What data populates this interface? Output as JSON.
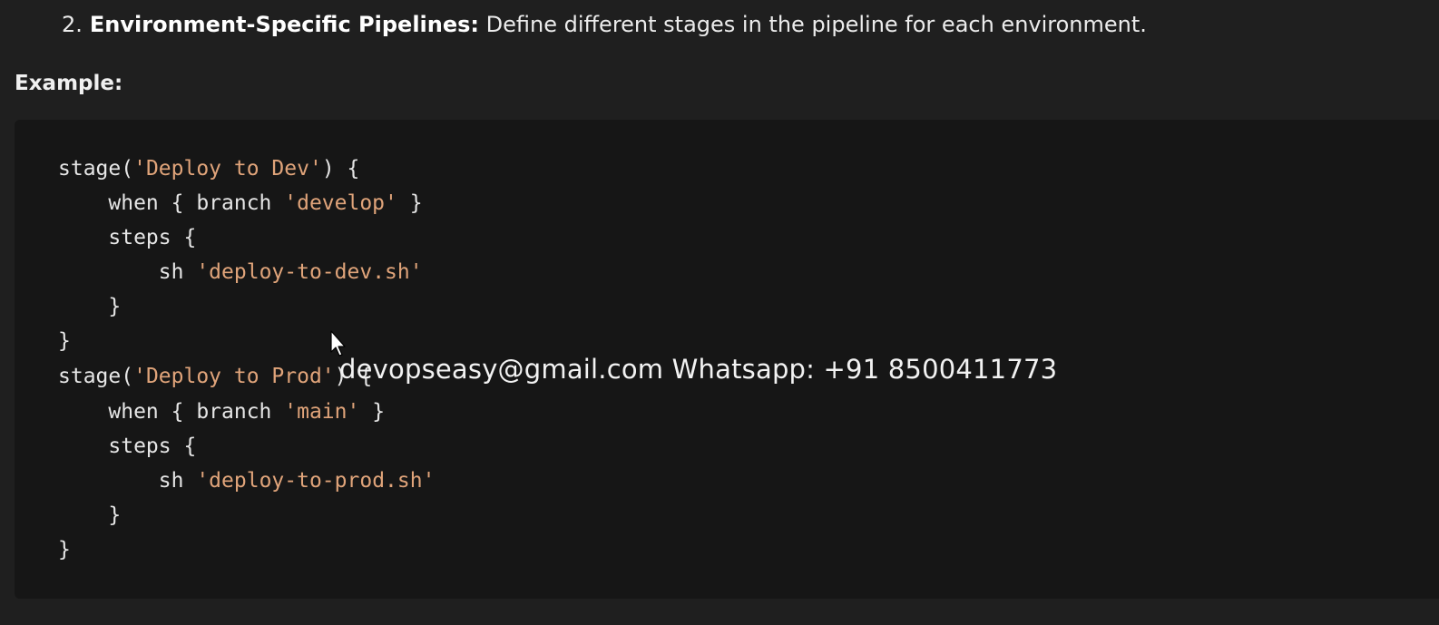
{
  "list": {
    "number": "2.",
    "bold": "Environment-Specific Pipelines:",
    "text": " Define different stages in the pipeline for each environment."
  },
  "example_label": "Example:",
  "code": {
    "lines": [
      {
        "pre": "stage(",
        "str": "'Deploy to Dev'",
        "post": ") {"
      },
      {
        "pre": "    when { branch ",
        "str": "'develop'",
        "post": " }"
      },
      {
        "pre": "    steps {",
        "str": "",
        "post": ""
      },
      {
        "pre": "        sh ",
        "str": "'deploy-to-dev.sh'",
        "post": ""
      },
      {
        "pre": "    }",
        "str": "",
        "post": ""
      },
      {
        "pre": "}",
        "str": "",
        "post": ""
      },
      {
        "pre": "stage(",
        "str": "'Deploy to Prod'",
        "post": ") {"
      },
      {
        "pre": "    when { branch ",
        "str": "'main'",
        "post": " }"
      },
      {
        "pre": "    steps {",
        "str": "",
        "post": ""
      },
      {
        "pre": "        sh ",
        "str": "'deploy-to-prod.sh'",
        "post": ""
      },
      {
        "pre": "    }",
        "str": "",
        "post": ""
      },
      {
        "pre": "}",
        "str": "",
        "post": ""
      }
    ]
  },
  "watermark": "devopseasy@gmail.com Whatsapp: +91 8500411773",
  "colors": {
    "background": "#1f1f1f",
    "code_background": "#161616",
    "string": "#e0a47a",
    "text": "#e6e6e6"
  },
  "icons": {
    "cursor": "mouse-pointer-icon"
  }
}
